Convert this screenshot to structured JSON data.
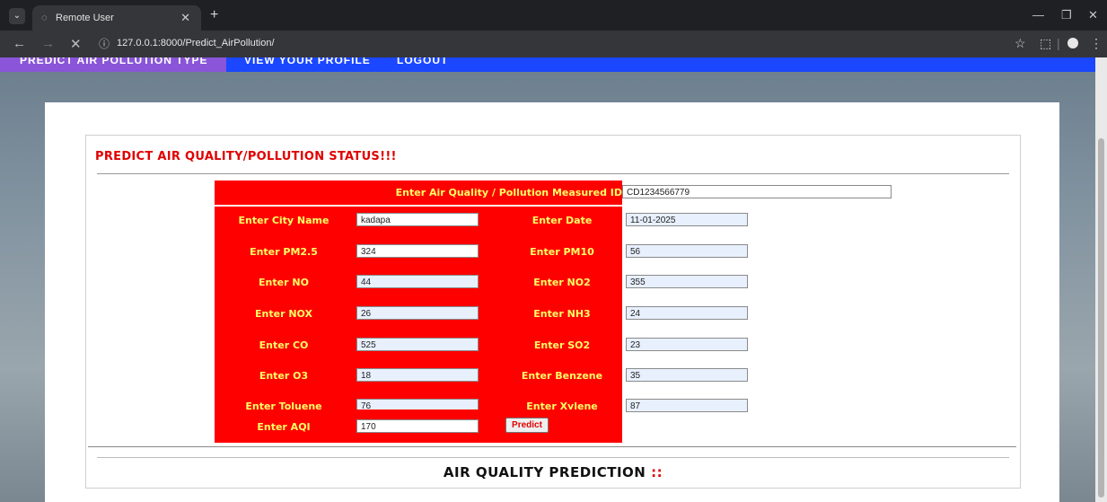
{
  "browser": {
    "tab_title": "Remote User",
    "url": "127.0.0.1:8000/Predict_AirPollution/"
  },
  "nav": {
    "items": [
      "PREDICT AIR POLLUTION TYPE",
      "VIEW YOUR PROFILE",
      "LOGOUT"
    ]
  },
  "form": {
    "heading": "PREDICT AIR QUALITY/POLLUTION STATUS!!!",
    "measured_id": {
      "label": "Enter Air Quality / Pollution Measured ID",
      "value": "CD1234566779"
    },
    "rows": [
      {
        "left": {
          "label": "Enter City Name",
          "value": "kadapa"
        },
        "right": {
          "label": "Enter Date",
          "value": "11-01-2025"
        }
      },
      {
        "left": {
          "label": "Enter PM2.5",
          "value": "324"
        },
        "right": {
          "label": "Enter PM10",
          "value": "56"
        }
      },
      {
        "left": {
          "label": "Enter NO",
          "value": "44"
        },
        "right": {
          "label": "Enter NO2",
          "value": "355"
        }
      },
      {
        "left": {
          "label": "Enter NOX",
          "value": "26"
        },
        "right": {
          "label": "Enter NH3",
          "value": "24"
        }
      },
      {
        "left": {
          "label": "Enter CO",
          "value": "525"
        },
        "right": {
          "label": "Enter SO2",
          "value": "23"
        }
      },
      {
        "left": {
          "label": "Enter O3",
          "value": "18"
        },
        "right": {
          "label": "Enter Benzene",
          "value": "35"
        }
      },
      {
        "left": {
          "label": "Enter Toluene",
          "value": "76"
        },
        "right": {
          "label": "Enter Xylene",
          "value": "87"
        }
      }
    ],
    "aqi": {
      "label": "Enter AQI",
      "value": "170"
    },
    "predict_label": "Predict"
  },
  "result": {
    "label": "AIR QUALITY PREDICTION",
    "value": "::"
  },
  "colors": {
    "red": "#ff0000",
    "label_text": "#ffff66",
    "nav_blue": "#1a47ff",
    "nav_active": "#8a55d8"
  }
}
